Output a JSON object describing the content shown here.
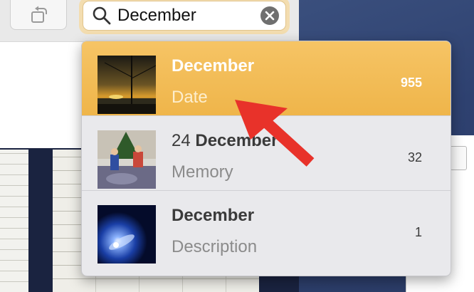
{
  "toolbar": {
    "rotate_icon": "rotate-icon"
  },
  "search": {
    "query": "December",
    "icons": {
      "search": "magnifier-icon",
      "clear": "clear-x-icon"
    }
  },
  "results": [
    {
      "title_prefix": "",
      "title_bold": "December",
      "subtitle": "Date",
      "count": "955",
      "selected": true,
      "thumb": "sunset-boat-thumbnail"
    },
    {
      "title_prefix": "24 ",
      "title_bold": "December",
      "subtitle": "Memory",
      "count": "32",
      "selected": false,
      "thumb": "christmas-kids-thumbnail"
    },
    {
      "title_prefix": "",
      "title_bold": "December",
      "subtitle": "Description",
      "count": "1",
      "selected": false,
      "thumb": "comet-thumbnail"
    }
  ],
  "colors": {
    "selected_row": "#efb54a",
    "arrow": "#e8322a",
    "search_focus": "#f3ddb0"
  }
}
